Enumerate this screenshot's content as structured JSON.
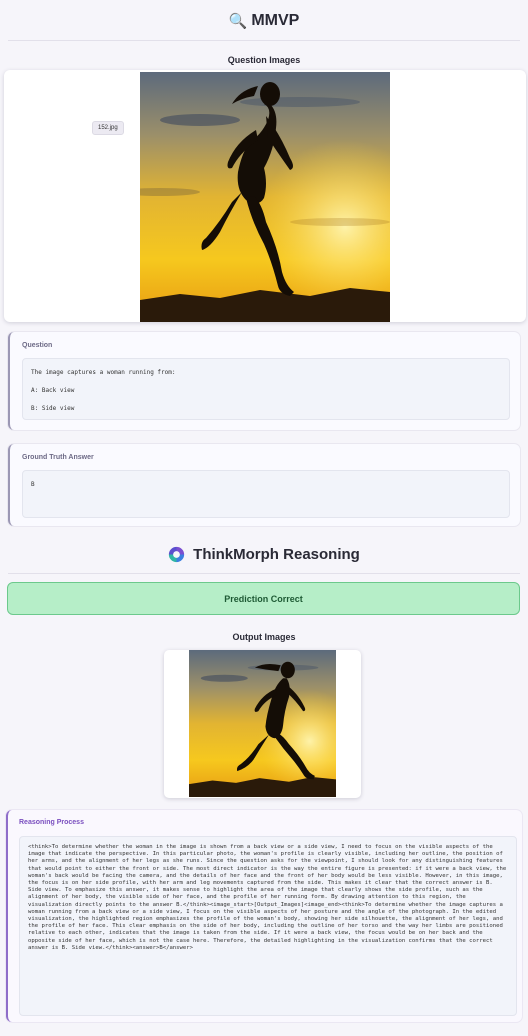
{
  "header": {
    "title": "MMVP",
    "icon": "magnifier-icon"
  },
  "question_images": {
    "label": "Question Images",
    "filename": "152.jpg"
  },
  "question": {
    "title": "Question",
    "prompt": "The image captures a woman running from:",
    "options": [
      "A: Back view",
      "B: Side view"
    ]
  },
  "ground_truth": {
    "title": "Ground Truth Answer",
    "answer": "B"
  },
  "model": {
    "name": "ThinkMorph Reasoning",
    "icon": "thinkmorph-logo-icon"
  },
  "prediction": {
    "label": "Prediction Correct",
    "color": "#b6eec8"
  },
  "output_images": {
    "label": "Output Images"
  },
  "reasoning": {
    "title": "Reasoning Process",
    "text": "<think>To determine whether the woman in the image is shown from a back view or a side view, I need to focus on the visible aspects of the image that indicate the perspective. In this particular photo, the woman's profile is clearly visible, including her outline, the position of her arms, and the alignment of her legs as she runs. Since the question asks for the viewpoint, I should look for any distinguishing features that would point to either the front or side. The most direct indicator is the way the entire figure is presented: if it were a back view, the woman's back would be facing the camera, and the details of her face and the front of her body would be less visible. However, in this image, the focus is on her side profile, with her arm and leg movements captured from the side. This makes it clear that the correct answer is B. Side view. To emphasize this answer, it makes sense to highlight the area of the image that clearly shows the side profile, such as the alignment of her body, the visible side of her face, and the profile of her running form. By drawing attention to this region, the visualization directly points to the answer B.</think><image_start>[Output_Images]<image_end><think>To determine whether the image captures a woman running from a back view or a side view, I focus on the visible aspects of her posture and the angle of the photograph. In the edited visualization, the highlighted region emphasizes the profile of the woman's body, showing her side silhouette, the alignment of her legs, and the profile of her face. This clear emphasis on the side of her body, including the outline of her torso and the way her limbs are positioned relative to each other, indicates that the image is taken from the side. If it were a back view, the focus would be on her back and the opposite side of her face, which is not the case here. Therefore, the detailed highlighting in the visualization confirms that the correct answer is B. Side view.</think><answer>B</answer>"
  }
}
